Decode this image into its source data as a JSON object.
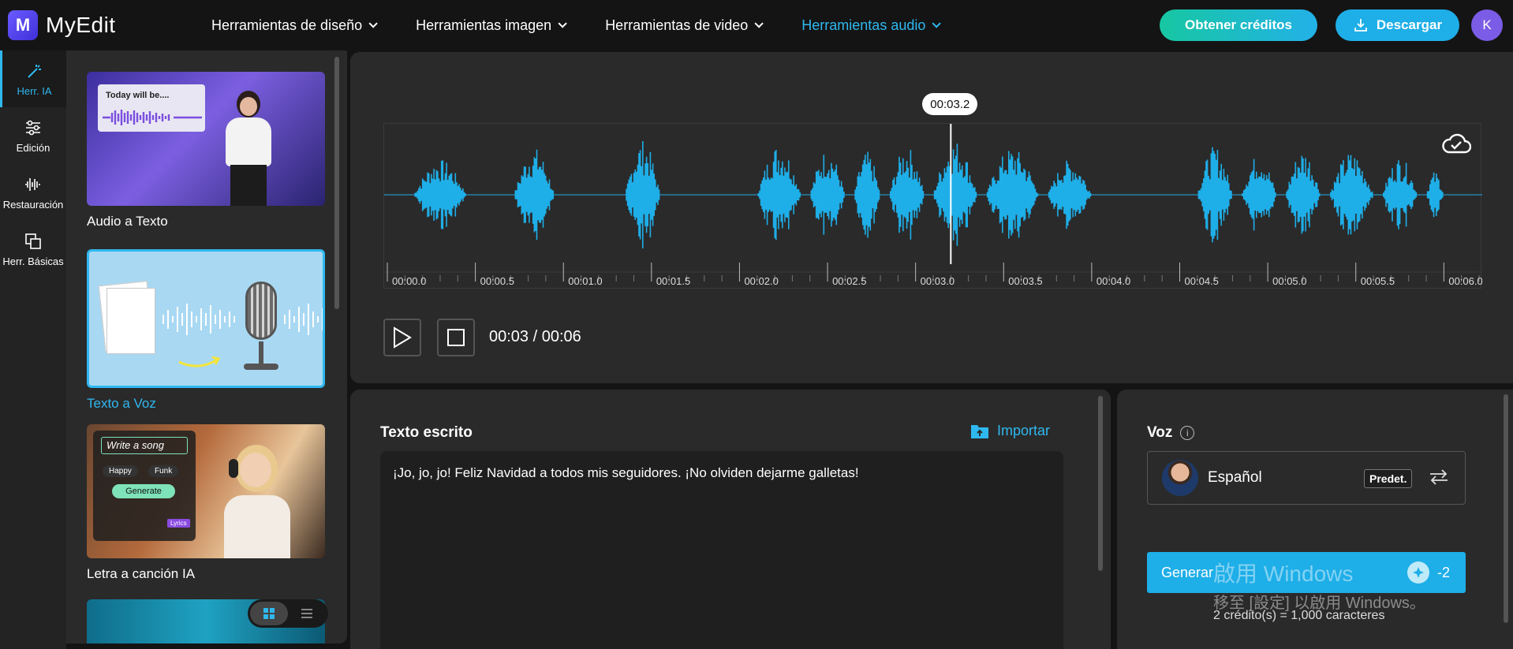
{
  "app": {
    "name": "MyEdit",
    "logo_letter": "M"
  },
  "nav": [
    {
      "label": "Herramientas de diseño",
      "active": false
    },
    {
      "label": "Herramientas imagen",
      "active": false
    },
    {
      "label": "Herramientas de video",
      "active": false
    },
    {
      "label": "Herramientas audio",
      "active": true
    }
  ],
  "header": {
    "credits_label": "Obtener créditos",
    "download_label": "Descargar",
    "user_initial": "K"
  },
  "rail": [
    {
      "label": "Herr. IA",
      "icon": "magic-wand-icon",
      "active": true
    },
    {
      "label": "Edición",
      "icon": "sliders-icon",
      "active": false
    },
    {
      "label": "Restauración",
      "icon": "waveform-icon",
      "active": false
    },
    {
      "label": "Herr. Básicas",
      "icon": "layers-icon",
      "active": false
    }
  ],
  "tools": [
    {
      "label": "Audio a Texto",
      "thumb_text": "Today will be....",
      "active": false
    },
    {
      "label": "Texto a Voz",
      "active": true
    },
    {
      "label": "Letra a canción IA",
      "thumb_text": "Write a song",
      "chips": [
        "Happy",
        "Funk"
      ],
      "button": "Generate",
      "tag": "Lyrics",
      "active": false
    }
  ],
  "player": {
    "playhead_label": "00:03.2",
    "time_readout": "00:03 / 00:06",
    "ticks": [
      "00:00.0",
      "00:00.5",
      "00:01.0",
      "00:01.5",
      "00:02.0",
      "00:02.5",
      "00:03.0",
      "00:03.5",
      "00:04.0",
      "00:04.5",
      "00:05.0",
      "00:05.5",
      "00:06.0"
    ],
    "duration_s": 6.2,
    "playhead_s": 3.2,
    "wave_color": "#1eaee8"
  },
  "text_panel": {
    "title": "Texto escrito",
    "import_label": "Importar",
    "content": "¡Jo, jo, jo! Feliz Navidad a todos mis seguidores. ¡No olviden dejarme galletas!"
  },
  "voice_panel": {
    "title": "Voz",
    "info": "i",
    "voice_name": "Español",
    "badge": "Predet.",
    "generate_label": "Generar",
    "cost": "-2",
    "credit_note": "2 crédito(s) = 1,000 caracteres"
  },
  "watermark": {
    "line1": "啟用 Windows",
    "line2": "移至 [設定] 以啟用 Windows。"
  }
}
